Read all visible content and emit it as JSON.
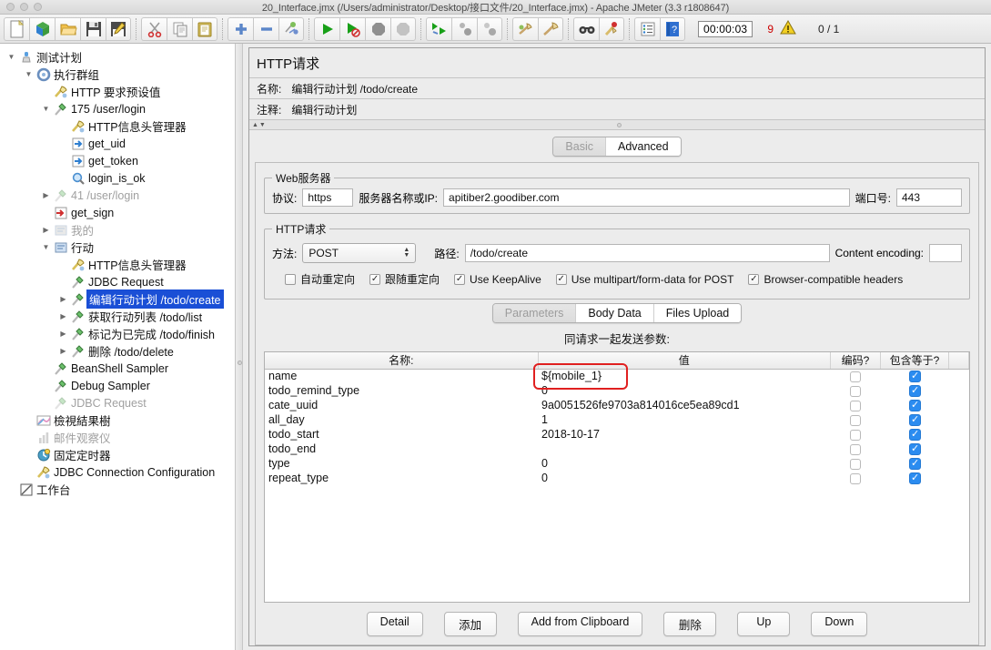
{
  "window": {
    "title": "20_Interface.jmx (/Users/administrator/Desktop/接口文件/20_Interface.jmx) - Apache JMeter (3.3 r1808647)"
  },
  "toolbar": {
    "icons": [
      "new-file-icon",
      "open-template-icon",
      "open-file-icon",
      "save-icon",
      "save-as-icon",
      "cut-icon",
      "copy-icon",
      "paste-icon",
      "expand-all-icon",
      "collapse-all-icon",
      "toggle-icon",
      "start-icon",
      "start-no-pauses-icon",
      "stop-icon",
      "shutdown-icon",
      "start-remote-all-icon",
      "stop-remote-all-icon",
      "shutdown-remote-all-icon",
      "clear-icon",
      "clear-all-icon",
      "search-icon",
      "search-reset-icon",
      "function-helper-icon",
      "help-icon"
    ],
    "timer": "00:00:03",
    "error_count": "9",
    "warning_icon": "warning-triangle-icon",
    "thread_ratio": "0 / 1"
  },
  "tree": {
    "nodes": [
      {
        "indent": 0,
        "twisty": "down",
        "icon": "test-plan-icon",
        "label": "测试计划",
        "path": "",
        "state": "normal"
      },
      {
        "indent": 1,
        "twisty": "down",
        "icon": "thread-group-icon",
        "label": "执行群组",
        "path": "",
        "state": "normal"
      },
      {
        "indent": 2,
        "twisty": "none",
        "icon": "config-icon",
        "label": "HTTP 要求预设值",
        "path": "",
        "state": "normal"
      },
      {
        "indent": 2,
        "twisty": "down",
        "icon": "sampler-icon",
        "label": "175",
        "path": "/user/login",
        "state": "normal"
      },
      {
        "indent": 3,
        "twisty": "none",
        "icon": "config-icon",
        "label": "HTTP信息头管理器",
        "path": "",
        "state": "normal"
      },
      {
        "indent": 3,
        "twisty": "none",
        "icon": "postproc-icon",
        "label": "get_uid",
        "path": "",
        "state": "normal"
      },
      {
        "indent": 3,
        "twisty": "none",
        "icon": "postproc-icon",
        "label": "get_token",
        "path": "",
        "state": "normal"
      },
      {
        "indent": 3,
        "twisty": "none",
        "icon": "assertion-icon",
        "label": "login_is_ok",
        "path": "",
        "state": "normal"
      },
      {
        "indent": 2,
        "twisty": "right",
        "icon": "sampler-disabled-icon",
        "label": "41",
        "path": "/user/login",
        "state": "disabled"
      },
      {
        "indent": 2,
        "twisty": "none",
        "icon": "preproc-icon",
        "label": "get_sign",
        "path": "",
        "state": "normal"
      },
      {
        "indent": 2,
        "twisty": "right",
        "icon": "controller-disabled-icon",
        "label": "我的",
        "path": "",
        "state": "disabled"
      },
      {
        "indent": 2,
        "twisty": "down",
        "icon": "controller-icon",
        "label": "行动",
        "path": "",
        "state": "normal"
      },
      {
        "indent": 3,
        "twisty": "none",
        "icon": "config-icon",
        "label": "HTTP信息头管理器",
        "path": "",
        "state": "normal"
      },
      {
        "indent": 3,
        "twisty": "none",
        "icon": "sampler-icon",
        "label": "JDBC Request",
        "path": "",
        "state": "normal"
      },
      {
        "indent": 3,
        "twisty": "right",
        "icon": "sampler-icon",
        "label": "编辑行动计划",
        "path": "/todo/create",
        "state": "selected"
      },
      {
        "indent": 3,
        "twisty": "right",
        "icon": "sampler-icon",
        "label": "获取行动列表",
        "path": "/todo/list",
        "state": "normal"
      },
      {
        "indent": 3,
        "twisty": "right",
        "icon": "sampler-icon",
        "label": "标记为已完成",
        "path": "/todo/finish",
        "state": "normal"
      },
      {
        "indent": 3,
        "twisty": "right",
        "icon": "sampler-icon",
        "label": "删除",
        "path": "/todo/delete",
        "state": "normal"
      },
      {
        "indent": 2,
        "twisty": "none",
        "icon": "sampler-icon",
        "label": "BeanShell Sampler",
        "path": "",
        "state": "normal"
      },
      {
        "indent": 2,
        "twisty": "none",
        "icon": "sampler-icon",
        "label": "Debug Sampler",
        "path": "",
        "state": "normal"
      },
      {
        "indent": 2,
        "twisty": "none",
        "icon": "sampler-disabled-icon",
        "label": "JDBC Request",
        "path": "",
        "state": "disabled"
      },
      {
        "indent": 1,
        "twisty": "none",
        "icon": "view-results-tree-icon",
        "label": "檢視結果樹",
        "path": "",
        "state": "normal"
      },
      {
        "indent": 1,
        "twisty": "none",
        "icon": "mail-visualizer-disabled-icon",
        "label": "邮件观察仪",
        "path": "",
        "state": "disabled"
      },
      {
        "indent": 1,
        "twisty": "none",
        "icon": "timer-icon",
        "label": "固定定时器",
        "path": "",
        "state": "normal"
      },
      {
        "indent": 1,
        "twisty": "none",
        "icon": "config-icon",
        "label": "JDBC Connection Configuration",
        "path": "",
        "state": "normal"
      },
      {
        "indent": 0,
        "twisty": "none",
        "icon": "workbench-icon",
        "label": "工作台",
        "path": "",
        "state": "normal"
      }
    ]
  },
  "panel": {
    "title": "HTTP请求",
    "name_label": "名称:",
    "name_value": "编辑行动计划 /todo/create",
    "comment_label": "注释:",
    "comment_value": "编辑行动计划",
    "mode_tabs": [
      {
        "label": "Basic",
        "active": true
      },
      {
        "label": "Advanced",
        "active": false
      }
    ],
    "web_server": {
      "legend": "Web服务器",
      "protocol_label": "协议:",
      "protocol_value": "https",
      "server_label": "服务器名称或IP:",
      "server_value": "apitiber2.goodiber.com",
      "port_label": "端口号:",
      "port_value": "443"
    },
    "http_request": {
      "legend": "HTTP请求",
      "method_label": "方法:",
      "method_value": "POST",
      "path_label": "路径:",
      "path_value": "/todo/create",
      "encoding_label": "Content encoding:",
      "encoding_value": ""
    },
    "options": [
      {
        "label": "自动重定向",
        "checked": false
      },
      {
        "label": "跟随重定向",
        "checked": true
      },
      {
        "label": "Use KeepAlive",
        "checked": true
      },
      {
        "label": "Use multipart/form-data for POST",
        "checked": true
      },
      {
        "label": "Browser-compatible headers",
        "checked": true
      }
    ],
    "data_tabs": [
      {
        "label": "Parameters",
        "active": true
      },
      {
        "label": "Body Data",
        "active": false
      },
      {
        "label": "Files Upload",
        "active": false
      }
    ],
    "params_subtitle": "同请求一起发送参数:",
    "params_table": {
      "columns": [
        "名称:",
        "值",
        "编码?",
        "包含等于?"
      ],
      "rows": [
        {
          "name": "name",
          "value": "${mobile_1}",
          "encode": false,
          "include_equals": true,
          "highlight": true
        },
        {
          "name": "todo_remind_type",
          "value": "0",
          "encode": false,
          "include_equals": true,
          "highlight": false
        },
        {
          "name": "cate_uuid",
          "value": "9a0051526fe9703a814016ce5ea89cd1",
          "encode": false,
          "include_equals": true,
          "highlight": false
        },
        {
          "name": "all_day",
          "value": "1",
          "encode": false,
          "include_equals": true,
          "highlight": false
        },
        {
          "name": "todo_start",
          "value": "2018-10-17",
          "encode": false,
          "include_equals": true,
          "highlight": false
        },
        {
          "name": "todo_end",
          "value": "",
          "encode": false,
          "include_equals": true,
          "highlight": false
        },
        {
          "name": "type",
          "value": "0",
          "encode": false,
          "include_equals": true,
          "highlight": false
        },
        {
          "name": "repeat_type",
          "value": "0",
          "encode": false,
          "include_equals": true,
          "highlight": false
        }
      ]
    },
    "buttons": [
      "Detail",
      "添加",
      "Add from Clipboard",
      "删除",
      "Up",
      "Down"
    ]
  },
  "colors": {
    "selection_blue": "#1a4fd6",
    "checkbox_blue": "#2b8cf0",
    "highlight_red": "#e02020",
    "error_red": "#cc0000"
  }
}
